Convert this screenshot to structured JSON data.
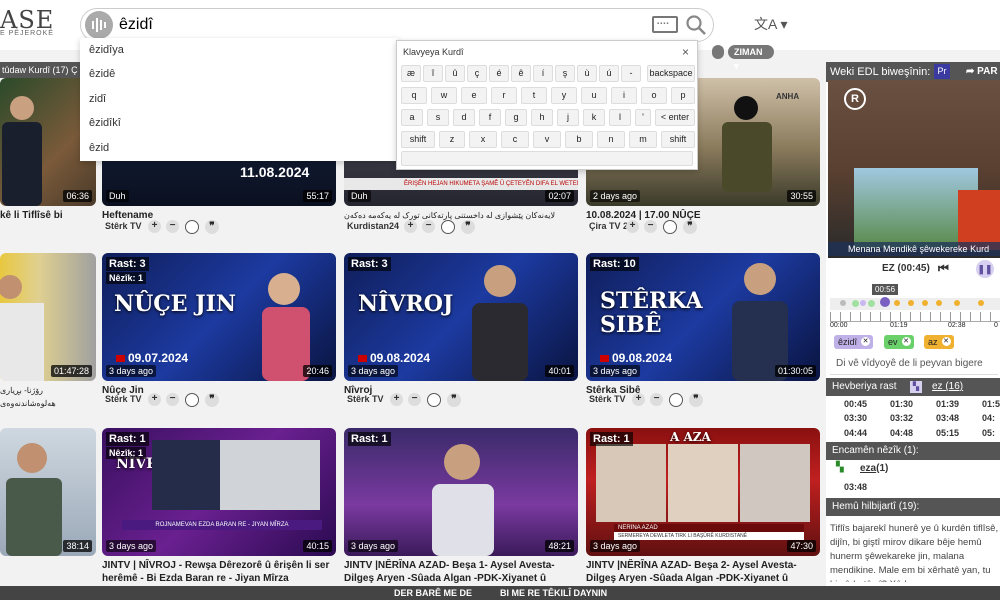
{
  "header": {
    "logo_text": "ASE",
    "logo_sub": "E PÊJEROKÊ",
    "search_value": "êzidî",
    "lang_icon": "translate-icon"
  },
  "suggestions": [
    "êzidîya",
    "êzidê",
    "zidî",
    "êzidîkî",
    "êzid"
  ],
  "keyboard": {
    "title": "Klavyeya Kurdî",
    "close": "×",
    "rows": [
      [
        "æ",
        "î",
        "û",
        "ç",
        "é",
        "ê",
        "í",
        "ş",
        "ù",
        "ú",
        "-",
        "backspace"
      ],
      [
        "q",
        "w",
        "e",
        "r",
        "t",
        "y",
        "u",
        "i",
        "o",
        "p"
      ],
      [
        "a",
        "s",
        "d",
        "f",
        "g",
        "h",
        "j",
        "k",
        "l",
        "'",
        "< enter"
      ],
      [
        "shift",
        "z",
        "x",
        "c",
        "v",
        "b",
        "n",
        "m",
        "shift"
      ]
    ]
  },
  "filters": {
    "ziman": "ZIMAN ▾",
    "category": "tûdaw Kurdî (17)",
    "cat_suffix": "Ç"
  },
  "videos": [
    {
      "duration": "06:36",
      "title": "kê li Tiflîsê bi"
    },
    {
      "badge": "Duh",
      "duration": "55:17",
      "date_text": "11.08.2024",
      "title": "Heftename",
      "channel": "Stêrk TV"
    },
    {
      "badge": "Duh",
      "duration": "02:07",
      "ticker": "ÊRIŞÊN HEJAN HIKUMETA ŞAMÊ Û ÇETEYÊN DIFA EL WETENÎ",
      "title": "لایەنەکان پێشوازی لە داخستنی پارتەکانی تورک لە یەکەمە دەکەن",
      "channel": "Kurdistan24"
    },
    {
      "badge": "2 days ago",
      "duration": "30:55",
      "logo": "ANHA",
      "title": "10.08.2024 | 17.00 NÛÇE",
      "channel": "Çira TV 2"
    },
    {
      "duration": "01:47:28",
      "title": "رۆژنا- بڕیاری هەلوەشاندنەوەی"
    },
    {
      "rast": "Rast: 3",
      "nezik": "Nêzîk: 1",
      "badge": "3 days ago",
      "duration": "20:46",
      "ptitle": "NÛÇE JIN",
      "pdate": "09.07.2024",
      "title": "Nûçe Jin",
      "channel": "Stêrk TV"
    },
    {
      "rast": "Rast: 3",
      "badge": "3 days ago",
      "duration": "40:01",
      "ptitle": "NÎVROJ",
      "pdate": "09.08.2024",
      "title": "Nîvroj",
      "channel": "Stêrk TV"
    },
    {
      "rast": "Rast: 10",
      "badge": "3 days ago",
      "duration": "01:30:05",
      "ptitle": "STÊRKA",
      "ptitle2": "SIBÊ",
      "pdate": "09.08.2024",
      "title": "Stêrka Sibê",
      "channel": "Stêrk TV"
    },
    {
      "duration": "38:14",
      "title": ""
    },
    {
      "rast": "Rast: 1",
      "nezik": "Nêzîk: 1",
      "badge": "3 days ago",
      "duration": "40:15",
      "logo": "NÎVRO",
      "ticker": "ROJNAMEVAN EZDA BARAN RE - JIYAN MÎRZA",
      "title": "JINTV | NÎVROJ - Rewşa Dêrezorê û êrişên li ser herêmê - Bi Ezda Baran re - Jiyan Mîrza"
    },
    {
      "rast": "Rast: 1",
      "badge": "3 days ago",
      "duration": "48:21",
      "title": "JINTV |NÊRÎNA AZAD- Beşa 1- Aysel Avesta-Dilgeş Aryen -Sûada Algan -PDK-Xiyanet û hevkariya we"
    },
    {
      "rast": "Rast: 1",
      "badge": "3 days ago",
      "duration": "47:30",
      "logo": "A AZA",
      "ticker": "NÊRÎNA AZAD",
      "ticker2": "SERMEREYA DEWLETA TIRK LI BAŞÛRÊ KURDISTANÊ",
      "title": "JINTV |NÊRÎNA AZAD- Beşa 2- Aysel Avesta-Dilgeş Aryen -Sûada Algan -PDK-Xiyanet û hevkariya we"
    }
  ],
  "sidebar": {
    "header": "Weki EDL biweşînin:",
    "pr": "Pr",
    "share": "PAR",
    "player_caption": "Menana Mendikê şêwekereke Kurd",
    "current": "EZ (00:45)",
    "tl_time": "00:56",
    "tl_labels": [
      "00:00",
      "01:19",
      "02:38",
      "0"
    ],
    "tags": [
      {
        "label": "êzidî",
        "color": "#b8a4e6"
      },
      {
        "label": "ev",
        "color": "#5fd85f"
      },
      {
        "label": "az",
        "color": "#f0b030"
      }
    ],
    "say_placeholder": "Di vê vîdyoyê de li peyvan bigere",
    "hevberiya": "Hevberiya rast",
    "ez_count": "ez (16)",
    "times": [
      [
        "00:45",
        "01:30",
        "01:39",
        "01:5"
      ],
      [
        "03:30",
        "03:32",
        "03:48",
        "04:"
      ],
      [
        "04:44",
        "04:48",
        "05:15",
        "05:"
      ]
    ],
    "encamen": "Encamên nêzîk (1):",
    "eza": "eza",
    "eza_count": "(1)",
    "eza_time": "03:48",
    "hemu": "Hemû hilbijartî (19):",
    "description": "Tiflîs bajarekî hunerê ye û kurdên tiflîsê, dijîn, bi giştî mirov dikare bêje hemû hunerm şêwekareke jin, malana mendikine. Male em bi xêrhatê yan, tu bi xêrhatê yî? Xêrha"
  },
  "footer": {
    "about": "DER BARÊ ME DE",
    "contact": "BI ME RE TÊKILÎ DAYNIN"
  }
}
